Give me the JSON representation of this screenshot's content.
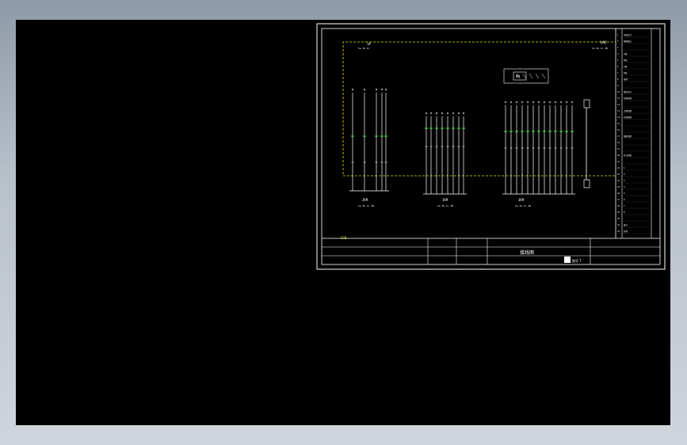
{
  "colors": {
    "background": "#000000",
    "frame": "#ffffff",
    "dashed_boundary": "#e6e600",
    "wire_green": "#33ff33",
    "wire_white": "#ffffff",
    "label_yellow": "#ffff66"
  },
  "drawing": {
    "title_block_name": "接线图",
    "title_block_sub": "图号 T",
    "page_mark": "CCB",
    "header_left": "1#",
    "header_left_sub": "Ia Ib Ic",
    "header_right": "1#柜",
    "header_right_sub": "Ia Ib Ic IN",
    "group1_label": "2KM",
    "group1_sub": "Ia Ib Ic IN",
    "group2_label": "1KM",
    "group2_sub": "Ia Ib Ic IN",
    "group3_label": "3KM",
    "group3_sub": "Ia Ib Ic IN",
    "top_box_label": "KM",
    "right_column_entries": [
      "电流信号",
      "辅助触点",
      "",
      "A相",
      "B相",
      "C相",
      "N线",
      "接地",
      "",
      "电压信号",
      "控制电源",
      "",
      "合闸回路",
      "分闸回路",
      "",
      "",
      "储能回路",
      "",
      "",
      "信号回路",
      "",
      "1",
      "2",
      "3",
      "4",
      "5",
      "6",
      "7",
      "8",
      "",
      "备注",
      "其他"
    ]
  }
}
